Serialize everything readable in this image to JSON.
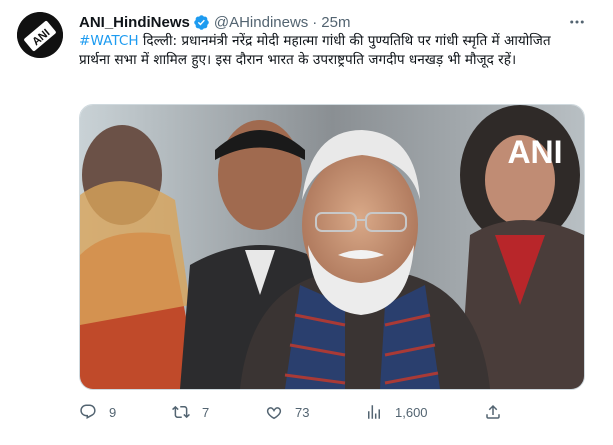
{
  "tweet": {
    "display_name": "ANI_HindiNews",
    "handle": "@AHindinews",
    "separator": "·",
    "time": "25m",
    "hashtag": "#WATCH",
    "body": " दिल्ली: प्रधानमंत्री नरेंद्र मोदी महात्मा गांधी की पुण्यतिथि पर गांधी स्मृति में आयोजित प्रार्थना सभा में शामिल हुए। इस दौरान भारत के उपराष्ट्रपति जगदीप धनखड़ भी मौजूद रहें।",
    "avatar_text": "ANI",
    "media_watermark": "ANI"
  },
  "actions": {
    "replies": "9",
    "retweets": "7",
    "likes": "73",
    "views": "1,600"
  },
  "icons": {
    "verified": "verified-badge-icon",
    "more": "more-icon",
    "reply": "reply-icon",
    "retweet": "retweet-icon",
    "like": "heart-icon",
    "views": "views-icon",
    "share": "share-icon"
  },
  "colors": {
    "accent": "#1d9bf0",
    "secondary_text": "#536471",
    "primary_text": "#0f1419"
  }
}
